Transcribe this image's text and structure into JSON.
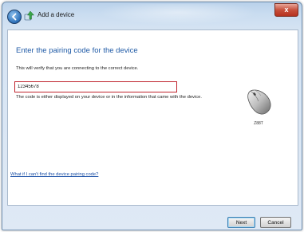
{
  "window": {
    "title": "Add a device"
  },
  "titlebar": {
    "close_label": "x"
  },
  "dialog": {
    "heading": "Enter the pairing code for the device",
    "description": "This will verify that you are connecting to the correct device.",
    "code_value": "12345678",
    "help_text": "The code is either displayed on your device or in the information that came with the device.",
    "device_name": "Z88T",
    "link_text": "What if I can't find the device pairing code?"
  },
  "buttons": {
    "next_label": "Next",
    "cancel_label": "Cancel"
  },
  "colors": {
    "heading": "#1f5aa6",
    "input_border": "#c0242e",
    "link": "#1a4fa6"
  }
}
